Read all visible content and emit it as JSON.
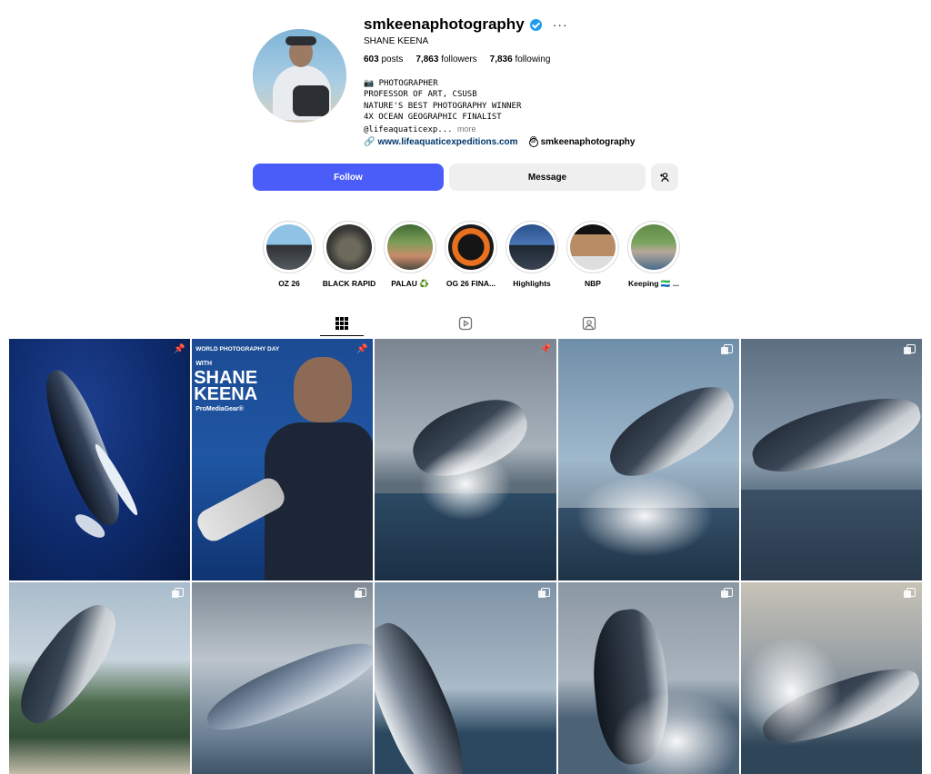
{
  "profile": {
    "username": "smkeenaphotography",
    "full_name": "SHANE KEENA",
    "posts_count": "603",
    "posts_label": "posts",
    "followers_count": "7,863",
    "followers_label": "followers",
    "following_count": "7,836",
    "following_label": "following",
    "bio_lines": [
      "📷 PHOTOGRAPHER",
      "PROFESSOR OF ART, CSUSB",
      "NATURE'S BEST PHOTOGRAPHY WINNER",
      "4X OCEAN GEOGRAPHIC FINALIST"
    ],
    "bio_truncated": "@lifeaquaticexp...",
    "more_label": "more",
    "website": "www.lifeaquaticexpeditions.com",
    "threads_handle": "smkeenaphotography",
    "verified_icon": "verified-badge-icon",
    "accent_color": "#4a5df9"
  },
  "actions": {
    "follow_label": "Follow",
    "message_label": "Message"
  },
  "highlights": [
    {
      "label": "OZ 26"
    },
    {
      "label": "BLACK RAPID"
    },
    {
      "label": "PALAU ♻️"
    },
    {
      "label": "OG 26 FINA..."
    },
    {
      "label": "Highlights"
    },
    {
      "label": "NBP"
    },
    {
      "label": "Keeping 🇸🇱 ..."
    }
  ],
  "tabs": [
    "posts-grid",
    "reels",
    "tagged"
  ],
  "posts": [
    {
      "kind": "pinned",
      "icon": "pin-icon"
    },
    {
      "kind": "pinned",
      "icon": "pin-icon",
      "poster_small": "WORLD PHOTOGRAPHY DAY",
      "poster_with": "WITH",
      "poster_name1": "SHANE",
      "poster_name2": "KEENA",
      "poster_brand": "ProMediaGear®"
    },
    {
      "kind": "pinned",
      "icon": "pin-icon"
    },
    {
      "kind": "carousel",
      "icon": "carousel-icon"
    },
    {
      "kind": "carousel",
      "icon": "carousel-icon"
    },
    {
      "kind": "carousel",
      "icon": "carousel-icon"
    },
    {
      "kind": "carousel",
      "icon": "carousel-icon"
    },
    {
      "kind": "carousel",
      "icon": "carousel-icon"
    },
    {
      "kind": "carousel",
      "icon": "carousel-icon"
    },
    {
      "kind": "carousel",
      "icon": "carousel-icon"
    }
  ]
}
